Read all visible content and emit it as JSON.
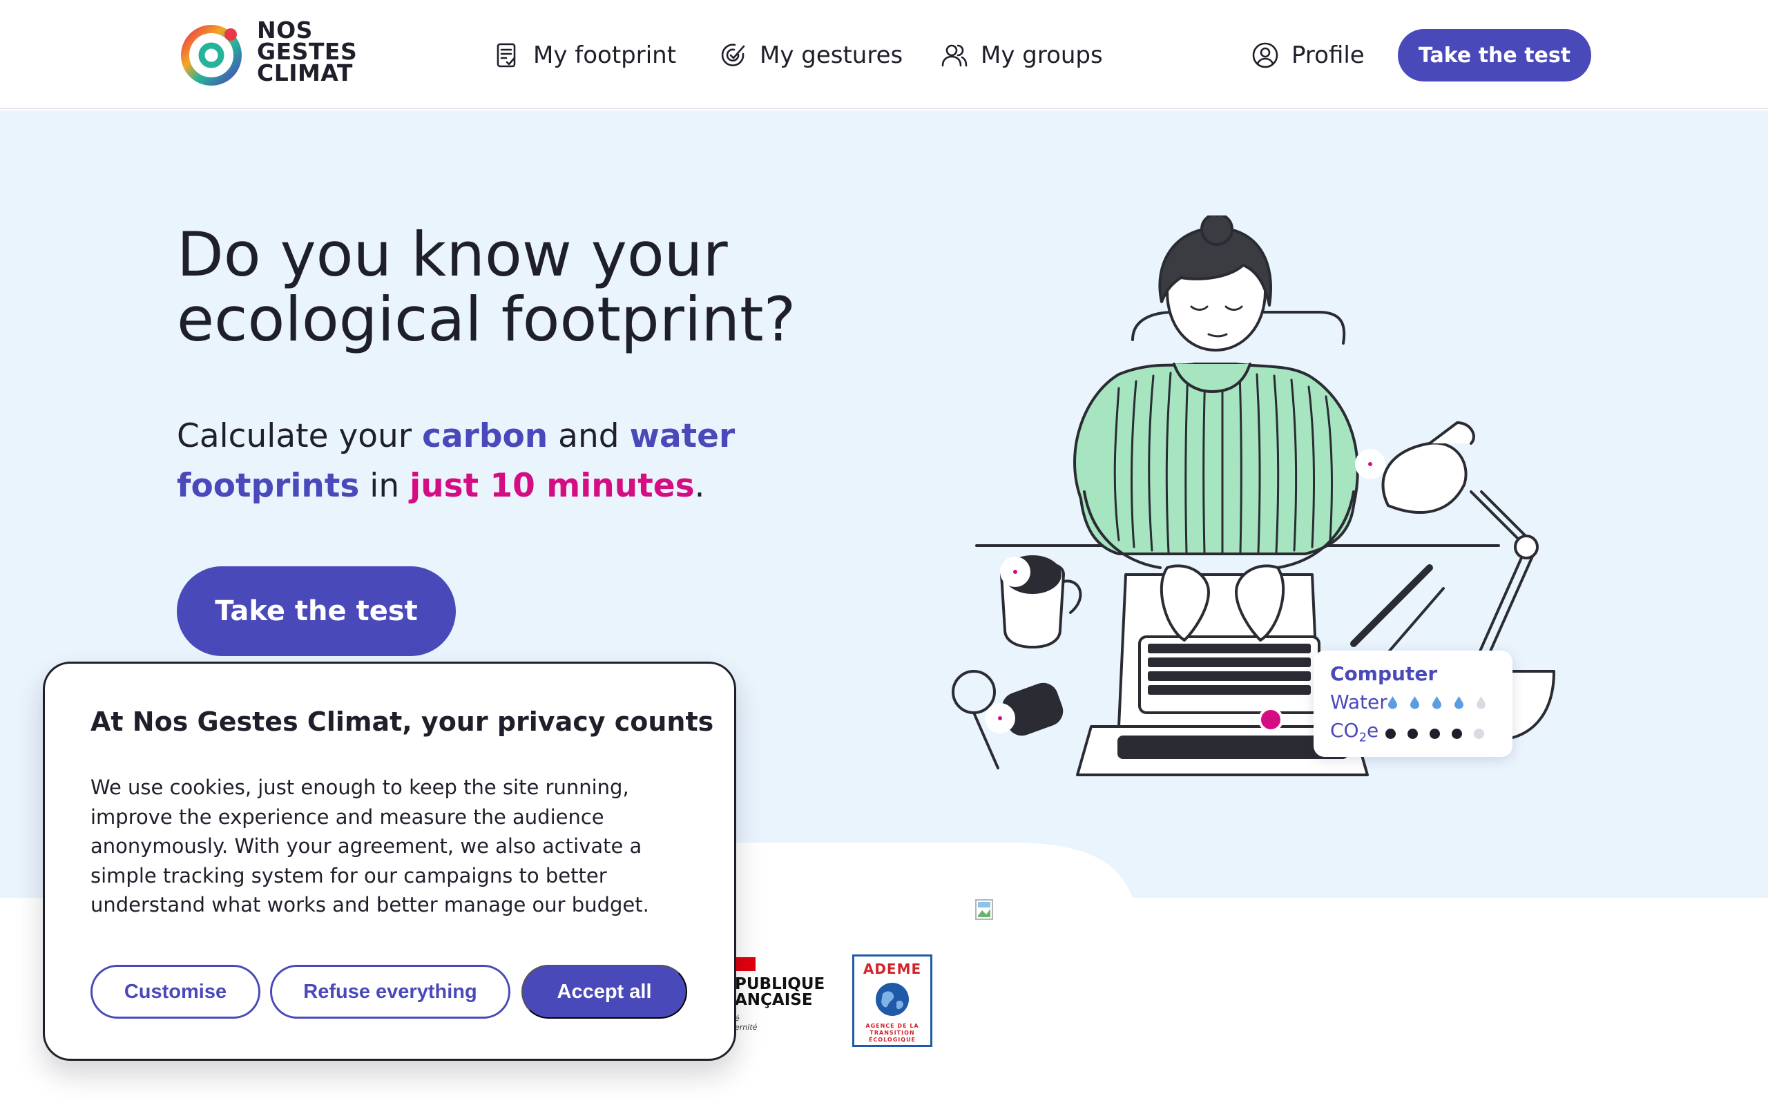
{
  "header": {
    "logo_lines": [
      "NOS",
      "GESTES",
      "CLIMAT"
    ],
    "nav": {
      "footprint": "My footprint",
      "gestures": "My gestures",
      "groups": "My groups",
      "profile": "Profile"
    },
    "cta": "Take the test"
  },
  "hero": {
    "title_line1": "Do you know your",
    "title_line2": "ecological footprint?",
    "subtitle": {
      "p1": "Calculate your ",
      "carbon": "carbon",
      "p2": " and ",
      "water": "water",
      "footprints": "footprints",
      "p3": " in ",
      "time": "just 10 minutes",
      "p4": "."
    },
    "cta": "Take the test",
    "info_card": {
      "title": "Computer",
      "water_label": "Water",
      "water_level": 4,
      "water_max": 5,
      "co2_label_main": "CO",
      "co2_label_sub": "2",
      "co2_label_end": "e",
      "co2_level": 4,
      "co2_max": 5
    }
  },
  "partners": {
    "rf_text_line1": "PUBLIQUE",
    "rf_text_line2": "ANÇAISE",
    "rf_motto_1": "é",
    "rf_motto_2": "ernité",
    "ademe_name": "ADEME",
    "ademe_sub": "AGENCE DE LA TRANSITION ÉCOLOGIQUE"
  },
  "cookie": {
    "title": "At Nos Gestes Climat, your privacy counts",
    "text": "We use cookies, just enough to keep the site running, improve the experience and measure the audience anonymously. With your agreement, we also activate a simple tracking system for our campaigns to better understand what works and better manage our budget.",
    "customise": "Customise",
    "refuse": "Refuse everything",
    "accept": "Accept all"
  },
  "colors": {
    "primary": "#4949ba",
    "accent_pink": "#d40d83",
    "hero_bg": "#eaf4fd",
    "sweater_green": "#a6e5c0"
  }
}
